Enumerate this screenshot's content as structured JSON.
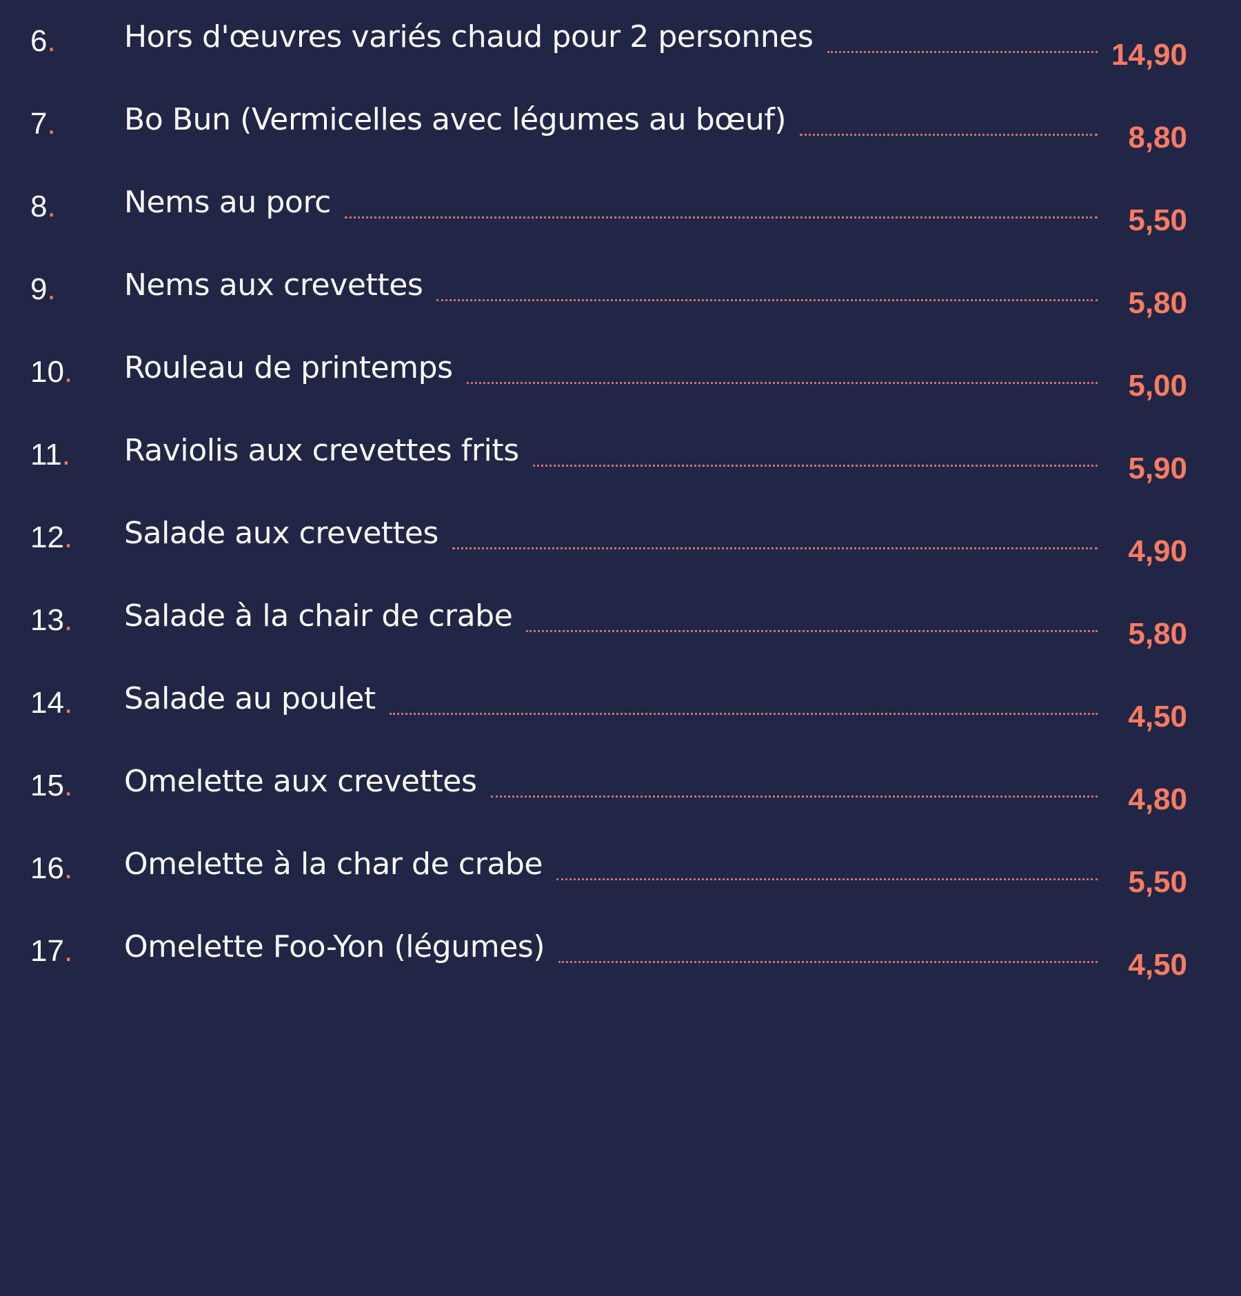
{
  "items": [
    {
      "number": "6",
      "dot": ".",
      "name": "Hors d'œuvres variés chaud pour 2 personnes",
      "price": "14,90"
    },
    {
      "number": "7",
      "dot": ".",
      "name": "Bo Bun (Vermicelles avec légumes au bœuf)",
      "price": "8,80"
    },
    {
      "number": "8",
      "dot": ".",
      "name": "Nems au porc",
      "price": "5,50"
    },
    {
      "number": "9",
      "dot": ".",
      "name": "Nems aux crevettes",
      "price": "5,80"
    },
    {
      "number": "10",
      "dot": ".",
      "name": "Rouleau de printemps",
      "price": "5,00"
    },
    {
      "number": "11",
      "dot": ".",
      "name": "Raviolis aux crevettes frits",
      "price": "5,90"
    },
    {
      "number": "12",
      "dot": ".",
      "name": "Salade aux crevettes",
      "price": "4,90"
    },
    {
      "number": "13",
      "dot": ".",
      "name": "Salade à la chair de crabe",
      "price": "5,80"
    },
    {
      "number": "14",
      "dot": ".",
      "name": "Salade au poulet",
      "price": "4,50"
    },
    {
      "number": "15",
      "dot": ".",
      "name": "Omelette aux crevettes",
      "price": "4,80"
    },
    {
      "number": "16",
      "dot": ".",
      "name": "Omelette à la char de crabe",
      "price": "5,50"
    },
    {
      "number": "17",
      "dot": ".",
      "name": "Omelette Foo-Yon (légumes)",
      "price": "4,50"
    }
  ],
  "colors": {
    "background": "#212647",
    "text": "#ffffff",
    "accent": "#f97b62",
    "leader": "#d0706c"
  }
}
